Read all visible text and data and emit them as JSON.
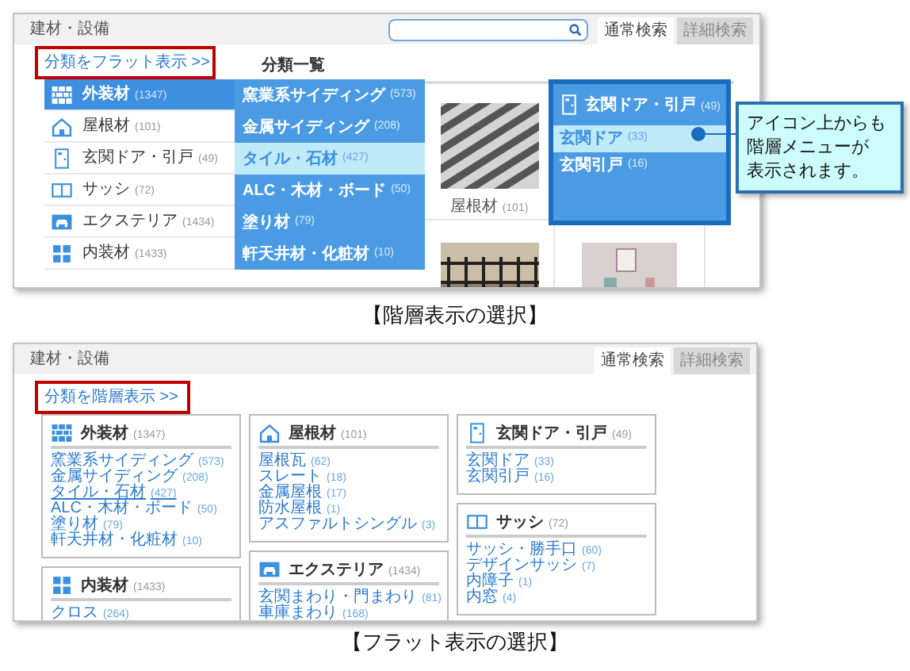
{
  "hierarchical_view": {
    "breadcrumb": "建材・設備",
    "tabs": [
      {
        "label": "通常検索",
        "selected": true
      },
      {
        "label": "詳細検索",
        "selected": false
      }
    ],
    "toggle_link": "分類をフラット表示 >>",
    "section_title": "分類一覧",
    "menu": [
      {
        "kind": "wall",
        "label": "外装材",
        "count": "(1347)",
        "selected": true
      },
      {
        "kind": "house",
        "label": "屋根材",
        "count": "(101)",
        "selected": false
      },
      {
        "kind": "door",
        "label": "玄関ドア・引戸",
        "count": "(49)",
        "selected": false
      },
      {
        "kind": "window",
        "label": "サッシ",
        "count": "(72)",
        "selected": false
      },
      {
        "kind": "car",
        "label": "エクステリア",
        "count": "(1434)",
        "selected": false
      },
      {
        "kind": "blocks",
        "label": "内装材",
        "count": "(1433)",
        "selected": false
      }
    ],
    "submenu": [
      {
        "label": "窯業系サイディング",
        "count": "(573)",
        "selected": false
      },
      {
        "label": "金属サイディング",
        "count": "(208)",
        "selected": false
      },
      {
        "label": "タイル・石材",
        "count": "(427)",
        "selected": true
      },
      {
        "label": "ALC・木材・ボード",
        "count": "(50)",
        "selected": false
      },
      {
        "label": "塗り材",
        "count": "(79)",
        "selected": false
      },
      {
        "label": "軒天井材・化粧材",
        "count": "(10)",
        "selected": false
      }
    ],
    "thumbnails": [
      {
        "kind": "picture",
        "label": "屋根材",
        "count": "(101)"
      },
      {
        "kind": "picture"
      },
      {
        "kind": "picture"
      }
    ],
    "popup": {
      "kind": "door",
      "label": "玄関ドア・引戸",
      "count": "(49)",
      "items": [
        {
          "label": "玄関ドア",
          "count": "(33)",
          "selected": true
        },
        {
          "label": "玄関引戸",
          "count": "(16)",
          "selected": false
        }
      ]
    },
    "callout": [
      "アイコン上からも",
      "階層メニューが",
      "表示されます。"
    ],
    "caption": "【階層表示の選択】"
  },
  "flat_view": {
    "breadcrumb": "建材・設備",
    "tabs": [
      {
        "label": "通常検索",
        "selected": true
      },
      {
        "label": "詳細検索",
        "selected": false
      }
    ],
    "toggle_link": "分類を階層表示 >>",
    "columns": [
      [
        {
          "kind": "wall",
          "label": "外装材",
          "count": "(1347)",
          "items": [
            {
              "label": "窯業系サイディング",
              "count": "(573)",
              "hovered": false
            },
            {
              "label": "金属サイディング",
              "count": "(208)",
              "hovered": false
            },
            {
              "label": "タイル・石材",
              "count": "(427)",
              "hovered": true
            },
            {
              "label": "ALC・木材・ボード",
              "count": "(50)",
              "hovered": false
            },
            {
              "label": "塗り材",
              "count": "(79)",
              "hovered": false
            },
            {
              "label": "軒天井材・化粧材",
              "count": "(10)",
              "hovered": false
            }
          ]
        },
        {
          "kind": "blocks",
          "label": "内装材",
          "count": "(1433)",
          "items": [
            {
              "label": "クロス",
              "count": "(264)"
            }
          ]
        }
      ],
      [
        {
          "kind": "house",
          "label": "屋根材",
          "count": "(101)",
          "items": [
            {
              "label": "屋根瓦",
              "count": "(62)"
            },
            {
              "label": "スレート",
              "count": "(18)"
            },
            {
              "label": "金属屋根",
              "count": "(17)"
            },
            {
              "label": "防水屋根",
              "count": "(1)"
            },
            {
              "label": "アスファルトシングル",
              "count": "(3)"
            }
          ]
        },
        {
          "kind": "car",
          "label": "エクステリア",
          "count": "(1434)",
          "items": [
            {
              "label": "玄関まわり・門まわり",
              "count": "(81)"
            },
            {
              "label": "車庫まわり",
              "count": "(168)"
            }
          ]
        }
      ],
      [
        {
          "kind": "door",
          "label": "玄関ドア・引戸",
          "count": "(49)",
          "items": [
            {
              "label": "玄関ドア",
              "count": "(33)"
            },
            {
              "label": "玄関引戸",
              "count": "(16)"
            }
          ]
        },
        {
          "kind": "window",
          "label": "サッシ",
          "count": "(72)",
          "items": [
            {
              "label": "サッシ・勝手口",
              "count": "(60)"
            },
            {
              "label": "デザインサッシ",
              "count": "(7)"
            },
            {
              "label": "内障子",
              "count": "(1)"
            },
            {
              "label": "内窓",
              "count": "(4)"
            }
          ]
        }
      ]
    ],
    "caption": "【フラット表示の選択】"
  }
}
